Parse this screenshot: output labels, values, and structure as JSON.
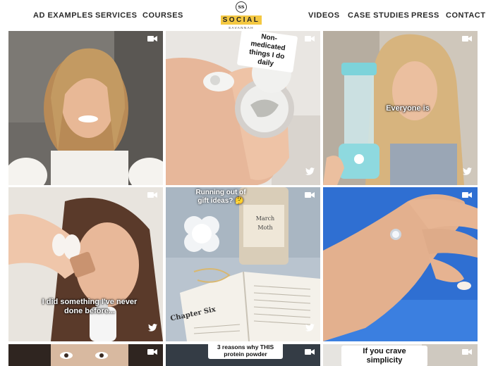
{
  "nav": {
    "left": [
      "AD EXAMPLES",
      "SERVICES",
      "COURSES"
    ],
    "right": [
      "VIDEOS",
      "CASE STUDIES",
      "PRESS",
      "CONTACT"
    ],
    "logo_mark": "ss",
    "logo_word": "SOCIAL",
    "logo_sub": "SAVANNAH"
  },
  "tiles": [
    {
      "caption": "",
      "twitter": false
    },
    {
      "caption": "Non-medicated things I do daily",
      "twitter": true
    },
    {
      "caption": "Everyone is",
      "twitter": true
    },
    {
      "caption": "I did something I've never done before...",
      "twitter": true
    },
    {
      "caption": "Running out of gift ideas? 🤔",
      "twitter": true,
      "book_text": "Chapter Six",
      "bottle_text": "March Moth"
    },
    {
      "caption": "",
      "twitter": false
    },
    {
      "caption": "",
      "twitter": false
    },
    {
      "caption": "3 reasons why THIS protein powder",
      "twitter": false
    },
    {
      "caption": "If you crave simplicity",
      "twitter": false
    }
  ],
  "colors": {
    "logo_highlight": "#f4c842",
    "nav_text": "#2a2a2a"
  },
  "icons": [
    "video-camera-icon",
    "twitter-icon"
  ]
}
